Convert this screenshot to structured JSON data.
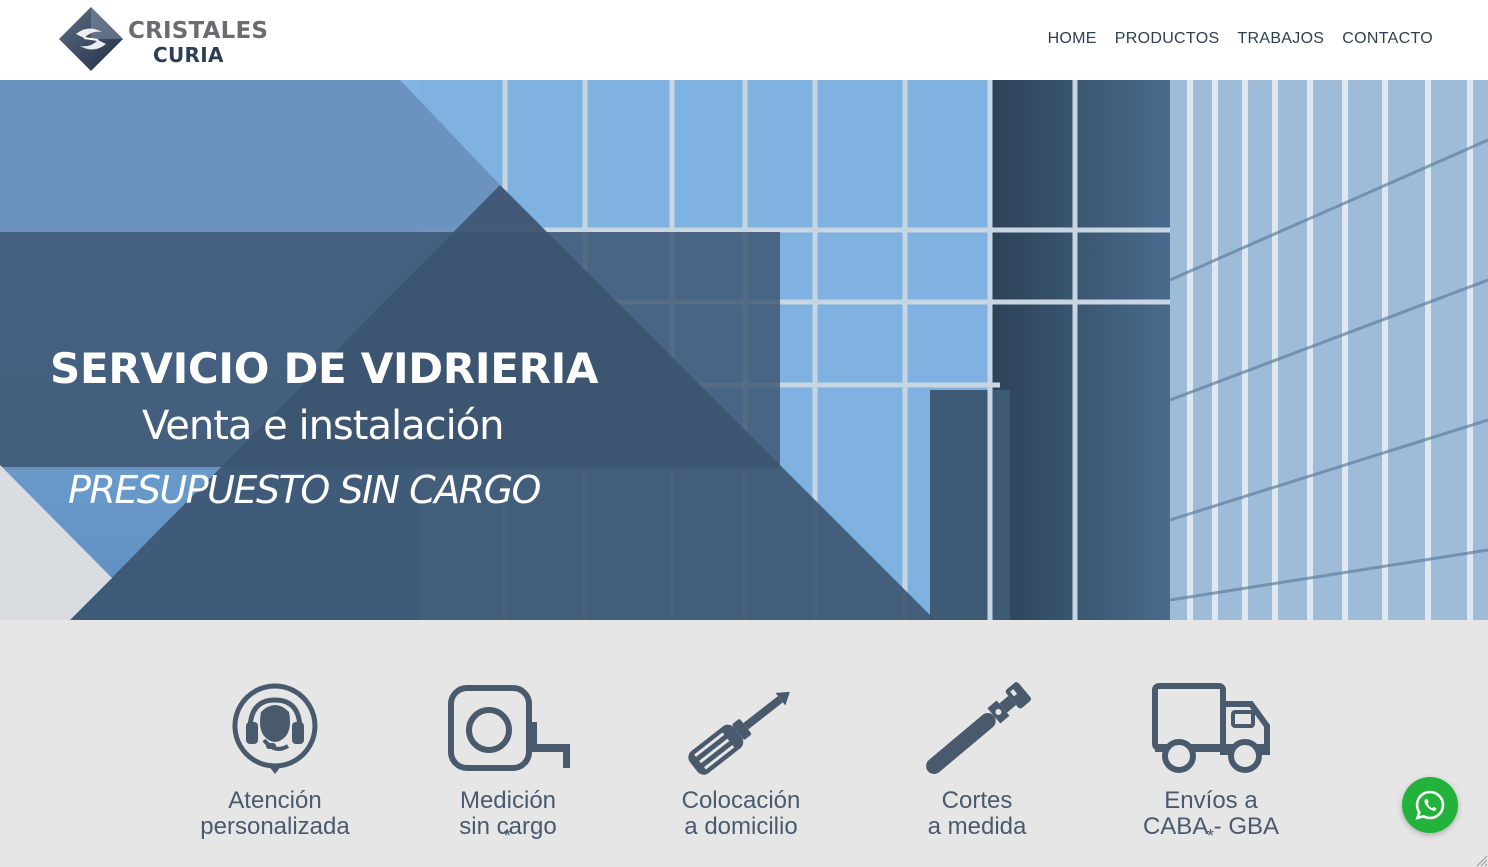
{
  "brand": {
    "line1": "CRISTALES",
    "line2": "CURIA",
    "logo_icon": "cc-diamond-logo"
  },
  "nav": {
    "items": [
      "HOME",
      "PRODUCTOS",
      "TRABAJOS",
      "CONTACTO"
    ]
  },
  "hero": {
    "title": "SERVICIO DE VIDRIERIA",
    "subtitle": "Venta e instalación",
    "tagline": "PRESUPUESTO SIN CARGO"
  },
  "features": [
    {
      "icon": "headset-icon",
      "line1": "Atención",
      "line2": "personalizada",
      "note": ""
    },
    {
      "icon": "tape-measure-icon",
      "line1": "Medición",
      "line2": "sin cargo",
      "note": "*"
    },
    {
      "icon": "screwdriver-icon",
      "line1": "Colocación",
      "line2": "a domicilio",
      "note": ""
    },
    {
      "icon": "glass-cutter-icon",
      "line1": "Cortes",
      "line2": "a medida",
      "note": ""
    },
    {
      "icon": "truck-icon",
      "line1": "Envíos a",
      "line2": "CABA - GBA",
      "note": "*"
    }
  ],
  "colors": {
    "brand_dark": "#2e3f55",
    "overlay": "#3c5470",
    "icon": "#4a5a6d",
    "whatsapp": "#23b33a"
  },
  "whatsapp": {
    "icon": "whatsapp-icon"
  }
}
